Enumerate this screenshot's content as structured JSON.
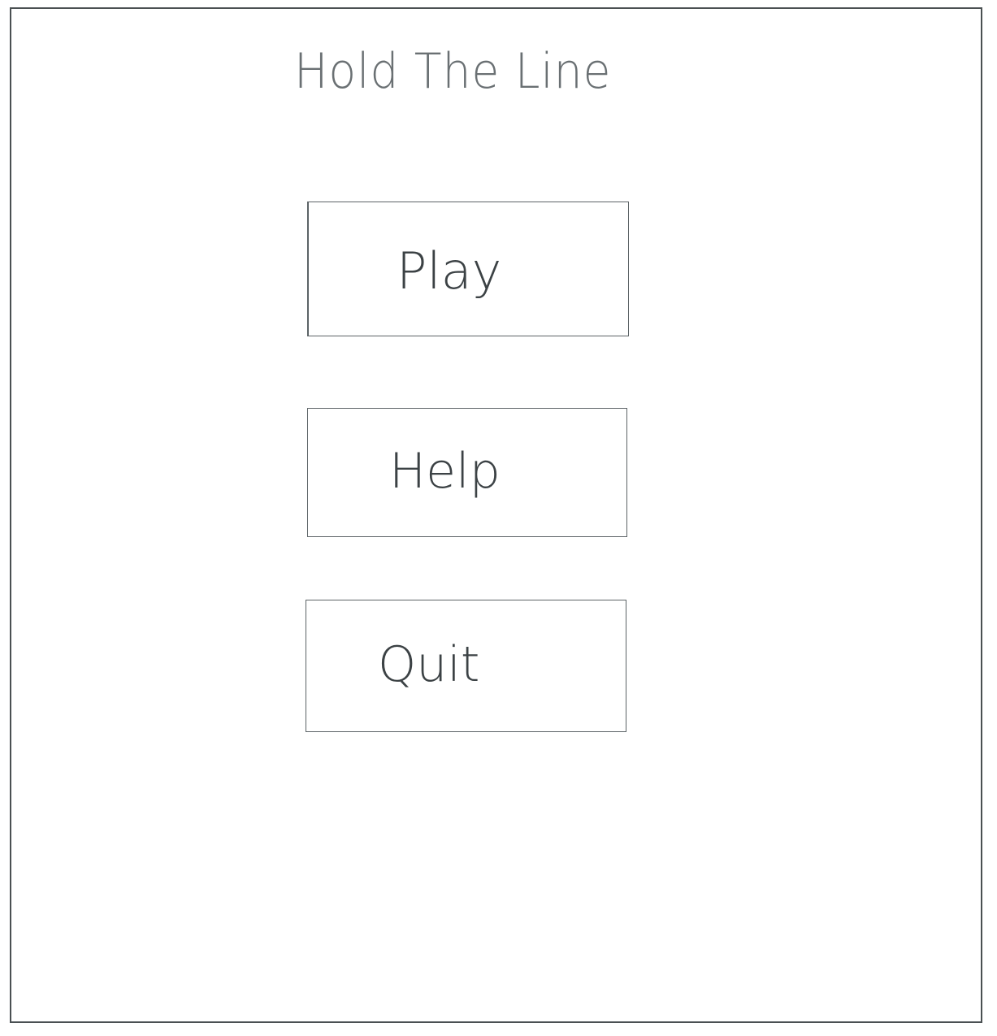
{
  "screen": {
    "title": "Hold The Line"
  },
  "menu": {
    "play_label": "Play",
    "help_label": "Help",
    "quit_label": "Quit"
  },
  "colors": {
    "background": "#ffffff",
    "stroke": "#4a5052",
    "text": "#3c4245"
  }
}
